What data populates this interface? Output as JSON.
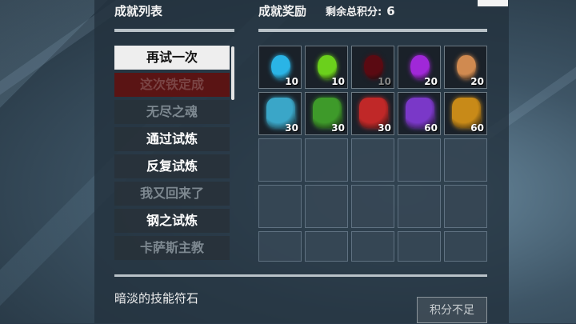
{
  "header": {
    "list_title": "成就列表",
    "rewards_title": "成就奖励",
    "points_label": "剩余总积分:",
    "points_value": "6"
  },
  "achievements": [
    {
      "label": "再试一次",
      "state": "selected"
    },
    {
      "label": "这次铁定成",
      "state": "red"
    },
    {
      "label": "无尽之魂",
      "state": "locked"
    },
    {
      "label": "通过试炼",
      "state": "unlocked"
    },
    {
      "label": "反复试炼",
      "state": "unlocked"
    },
    {
      "label": "我又回来了",
      "state": "locked"
    },
    {
      "label": "钢之试炼",
      "state": "unlocked"
    },
    {
      "label": "卡萨斯主教",
      "state": "locked"
    }
  ],
  "rewards": [
    {
      "name": "rune-cyan-icon",
      "cost": "10",
      "color": "#2ab4e6",
      "dim": false
    },
    {
      "name": "rune-green-icon",
      "cost": "10",
      "color": "#6bd01c",
      "dim": false
    },
    {
      "name": "rune-red-dark-icon",
      "cost": "10",
      "color": "#5a0a12",
      "dim": true
    },
    {
      "name": "rune-purple-icon",
      "cost": "20",
      "color": "#a028d8",
      "dim": false
    },
    {
      "name": "rune-orange-icon",
      "cost": "20",
      "color": "#d08a50",
      "dim": false
    },
    {
      "name": "rune-crystal-cyan-icon",
      "cost": "30",
      "color": "#3aa6c8",
      "dim": false
    },
    {
      "name": "rune-crystal-green-icon",
      "cost": "30",
      "color": "#3e9a2a",
      "dim": false
    },
    {
      "name": "rune-crystal-red-icon",
      "cost": "30",
      "color": "#c02828",
      "dim": false
    },
    {
      "name": "rune-crystal-purple-icon",
      "cost": "60",
      "color": "#7a38c8",
      "dim": false
    },
    {
      "name": "rune-crystal-gold-icon",
      "cost": "60",
      "color": "#c88a18",
      "dim": false
    }
  ],
  "detail": {
    "title": "暗淡的技能符石",
    "redeem_label": "积分不足"
  }
}
